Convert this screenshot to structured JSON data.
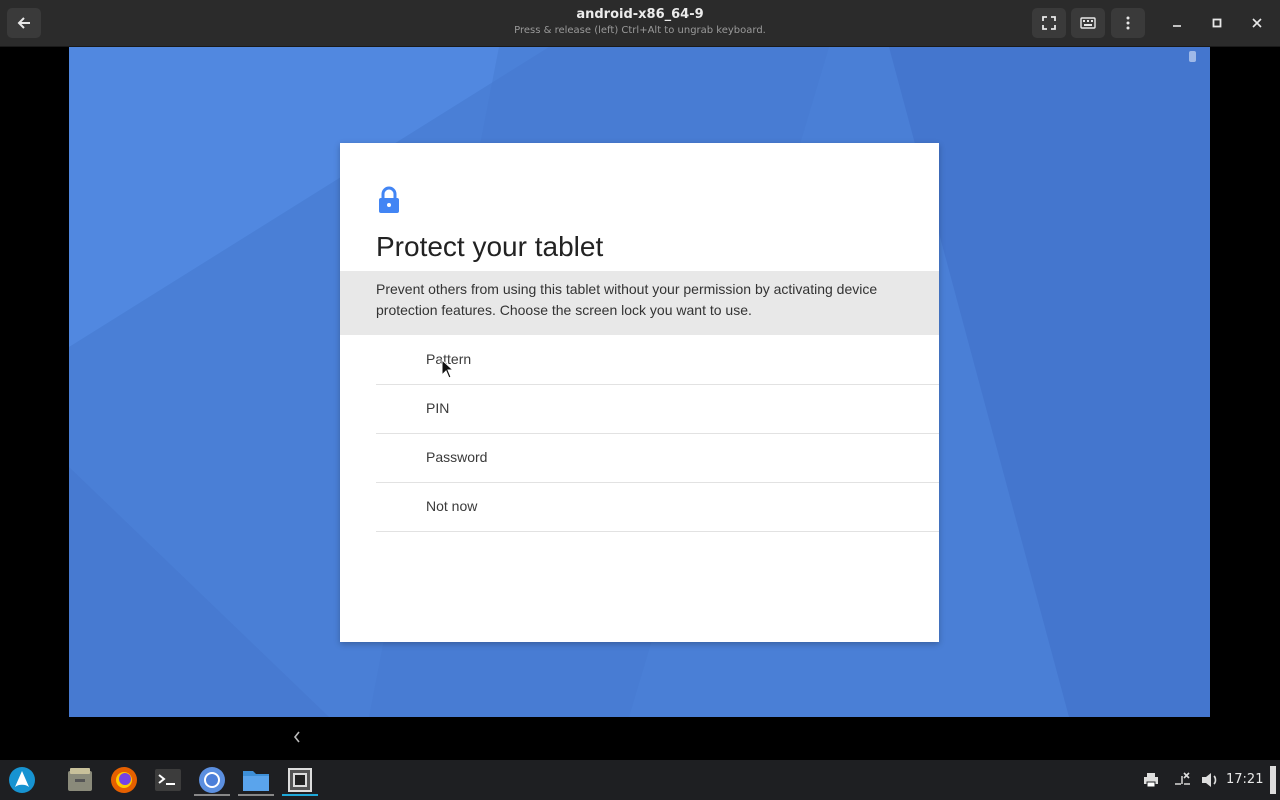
{
  "window": {
    "title": "android-x86_64-9",
    "subtitle": "Press & release (left) Ctrl+Alt to ungrab keyboard."
  },
  "dialog": {
    "icon": "lock-icon",
    "title": "Protect your tablet",
    "description": "Prevent others from using this tablet without your permission by activating device protection features. Choose the screen lock you want to use.",
    "options": [
      "Pattern",
      "PIN",
      "Password",
      "Not now"
    ]
  },
  "taskbar": {
    "apps": [
      "arch-linux-icon",
      "file-manager-icon",
      "firefox-icon",
      "terminal-icon",
      "chromium-icon",
      "files-icon",
      "virt-manager-icon"
    ],
    "clock": "17:21"
  },
  "colors": {
    "android_bg": "#4a7fd6",
    "accent": "#4285f4"
  }
}
